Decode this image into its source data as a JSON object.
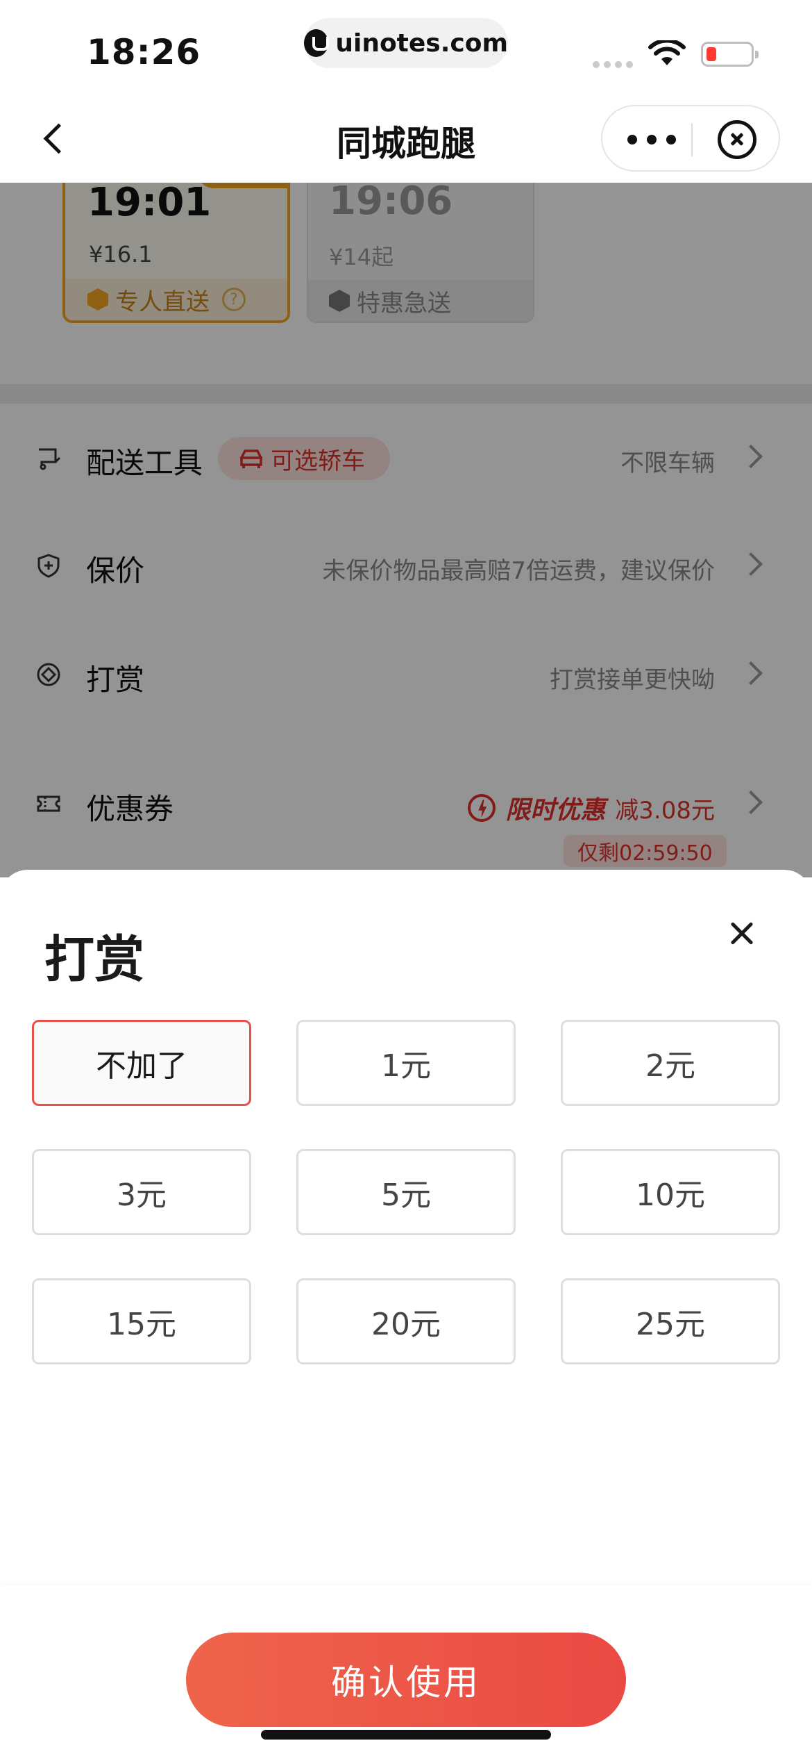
{
  "status_bar": {
    "time": "18:26",
    "url": "uinotes.com"
  },
  "nav": {
    "title": "同城跑腿"
  },
  "delivery_cards": [
    {
      "time": "19:01",
      "price": "¥16.1",
      "label": "专人直送",
      "selected": true
    },
    {
      "time": "19:06",
      "price": "¥14起",
      "label": "特惠急送",
      "selected": false
    }
  ],
  "rows": {
    "tool": {
      "label": "配送工具",
      "tag": "可选轿车",
      "value": "不限车辆"
    },
    "insure": {
      "label": "保价",
      "value": "未保价物品最高赔7倍运费，建议保价"
    },
    "tip": {
      "label": "打赏",
      "value": "打赏接单更快呦"
    },
    "coupon": {
      "label": "优惠券",
      "promo_tag": "限时优惠",
      "promo_amount": "减3.08元",
      "countdown": "仅剩02:59:50"
    }
  },
  "sheet": {
    "title": "打赏",
    "options": [
      "不加了",
      "1元",
      "2元",
      "3元",
      "5元",
      "10元",
      "15元",
      "20元",
      "25元"
    ],
    "selected_option": "不加了",
    "confirm_label": "确认使用"
  },
  "colors": {
    "accent": "#e8504a",
    "orange": "#f5a623",
    "promo_red": "#e0312b"
  }
}
